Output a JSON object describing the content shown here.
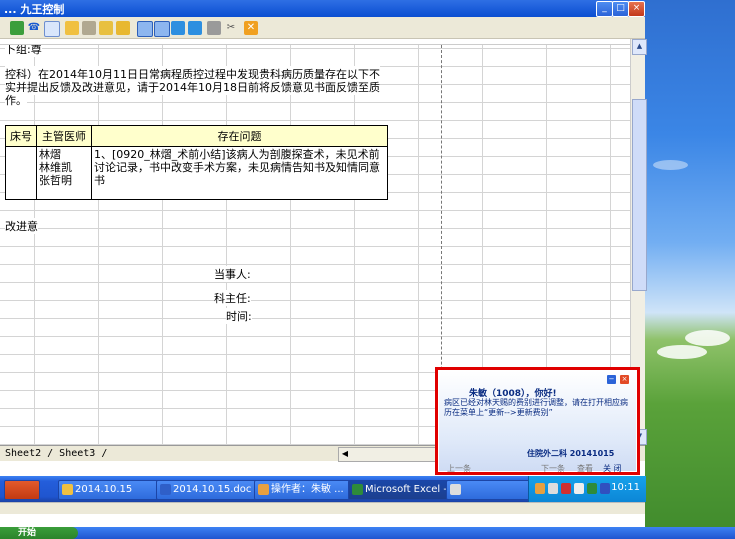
{
  "window": {
    "title": "... 九王控制"
  },
  "sheet": {
    "header_fragment": "卜组:尊",
    "para_line1": "控科）在2014年10月11日日常病程质控过程中发现贵科病历质量存在以下不",
    "para_line2": "实并提出反馈及改进意见，请于2014年10月18日前将反馈意见书面反馈至质",
    "para_line3": "作。",
    "table": {
      "headers": [
        "床号",
        "主管医师",
        "存在问题"
      ],
      "row": {
        "bed": "",
        "doctors": [
          "林熠",
          "林维凯",
          "张哲明"
        ],
        "problem": "1、[0920_林熠_术前小结]该病人为剖腹探查术，未见术前讨论记录，书中改变手术方案，未见病情告知书及知情同意书"
      }
    },
    "improve_label": "改进意",
    "sign_party": "当事人:",
    "sign_director": "科主任:",
    "sign_time": "时间:"
  },
  "sheet_tabs": {
    "text": "Sheet2 / Sheet3 /"
  },
  "taskbar": {
    "items": [
      {
        "label": "2014.10.15"
      },
      {
        "label": "2014.10.15.doc ..."
      },
      {
        "label": "操作者：朱敏 ..."
      },
      {
        "label": "Microsoft Excel - ..."
      },
      {
        "label": ""
      }
    ],
    "clock": "10:11"
  },
  "bottom_bar": {
    "start_label": "开始"
  },
  "popup": {
    "greeting": "朱敏（1008），你好!",
    "message": "病区已经对林天赐的费别进行调整，请在打开相应病历在菜单上“更新-->更新费别”",
    "sender": "住院外二科  20141015",
    "prev": "上一条",
    "next": "下一条",
    "view": "查看",
    "close": "关 闭"
  },
  "colors": {
    "highlight": "#e00000",
    "header_fill": "#ffffcc",
    "taskbar": "#245edb"
  }
}
